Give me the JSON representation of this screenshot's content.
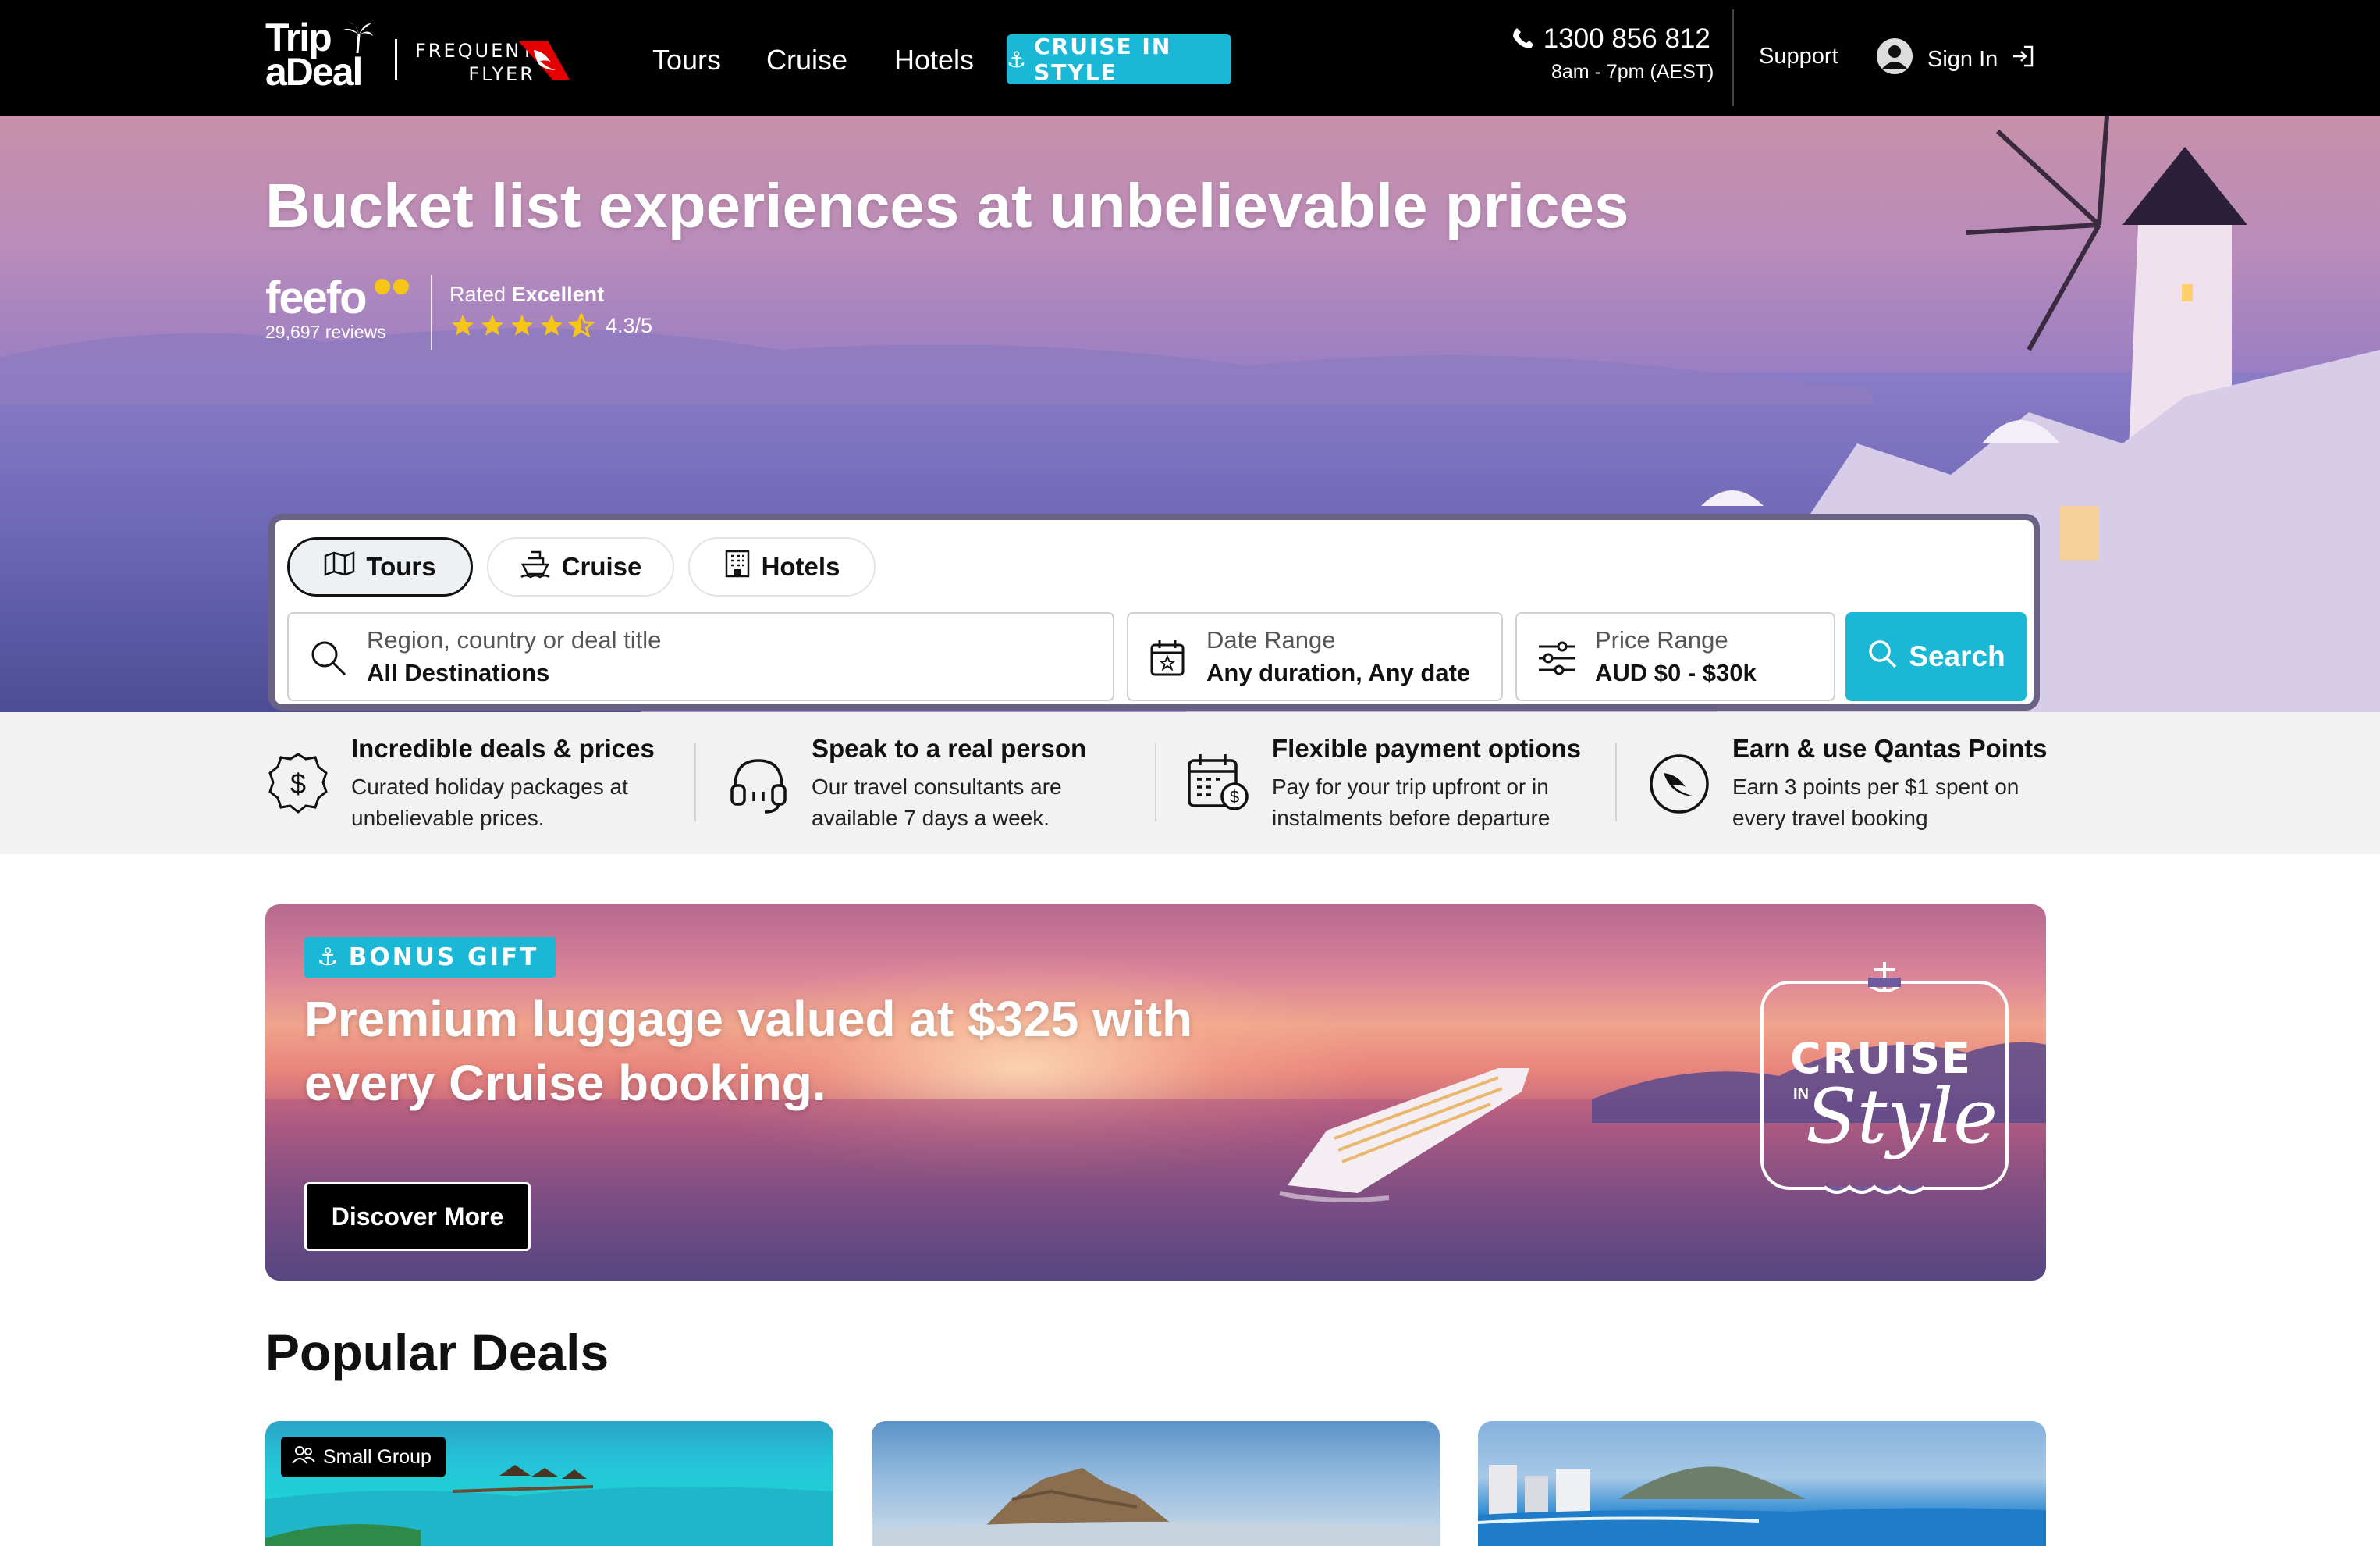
{
  "nav": {
    "logo_line1": "Trip",
    "logo_line2": "aDeal",
    "partner_line1": "FREQUENT",
    "partner_line2": "FLYER",
    "links": [
      "Tours",
      "Cruise",
      "Hotels"
    ],
    "cruise_in_style": "CRUISE IN STYLE",
    "phone": "1300 856 812",
    "hours": "8am - 7pm (AEST)",
    "support": "Support",
    "sign_in": "Sign In"
  },
  "hero": {
    "title": "Bucket list experiences at unbelievable prices",
    "feefo_brand": "feefo",
    "reviews": "29,697 reviews",
    "rated_prefix": "Rated",
    "rated_word": "Excellent",
    "score": "4.3/5",
    "stars": 4.3
  },
  "search": {
    "tabs": [
      {
        "label": "Tours",
        "active": true,
        "icon": "map-icon"
      },
      {
        "label": "Cruise",
        "active": false,
        "icon": "ship-icon"
      },
      {
        "label": "Hotels",
        "active": false,
        "icon": "building-icon"
      }
    ],
    "destination": {
      "label": "Region, country or deal title",
      "value": "All Destinations"
    },
    "date": {
      "label": "Date Range",
      "value": "Any duration, Any date"
    },
    "price": {
      "label": "Price Range",
      "value": "AUD $0 - $30k"
    },
    "button": "Search"
  },
  "features": [
    {
      "title": "Incredible deals & prices",
      "desc": "Curated holiday packages at unbelievable prices.",
      "icon": "dollar-badge-icon"
    },
    {
      "title": "Speak to a real person",
      "desc": "Our travel consultants are available 7 days a week.",
      "icon": "headset-icon"
    },
    {
      "title": "Flexible payment options",
      "desc": "Pay for your trip upfront or in instalments before departure",
      "icon": "calendar-dollar-icon"
    },
    {
      "title": "Earn & use Qantas Points",
      "desc": "Earn 3 points per $1 spent on every travel booking",
      "icon": "qantas-icon"
    }
  ],
  "promo": {
    "badge": "BONUS GIFT",
    "title": "Premium luggage valued at $325 with every Cruise booking.",
    "button": "Discover More",
    "logo_word1": "CRUISE",
    "logo_word2": "IN",
    "logo_word3": "Style"
  },
  "popular": {
    "title": "Popular Deals",
    "cards": [
      {
        "tag": "Small Group"
      },
      {
        "tag": ""
      },
      {
        "tag": ""
      }
    ]
  },
  "colors": {
    "accent": "#1ab8d6",
    "nav_bg": "#000000",
    "star": "#f5c518"
  }
}
